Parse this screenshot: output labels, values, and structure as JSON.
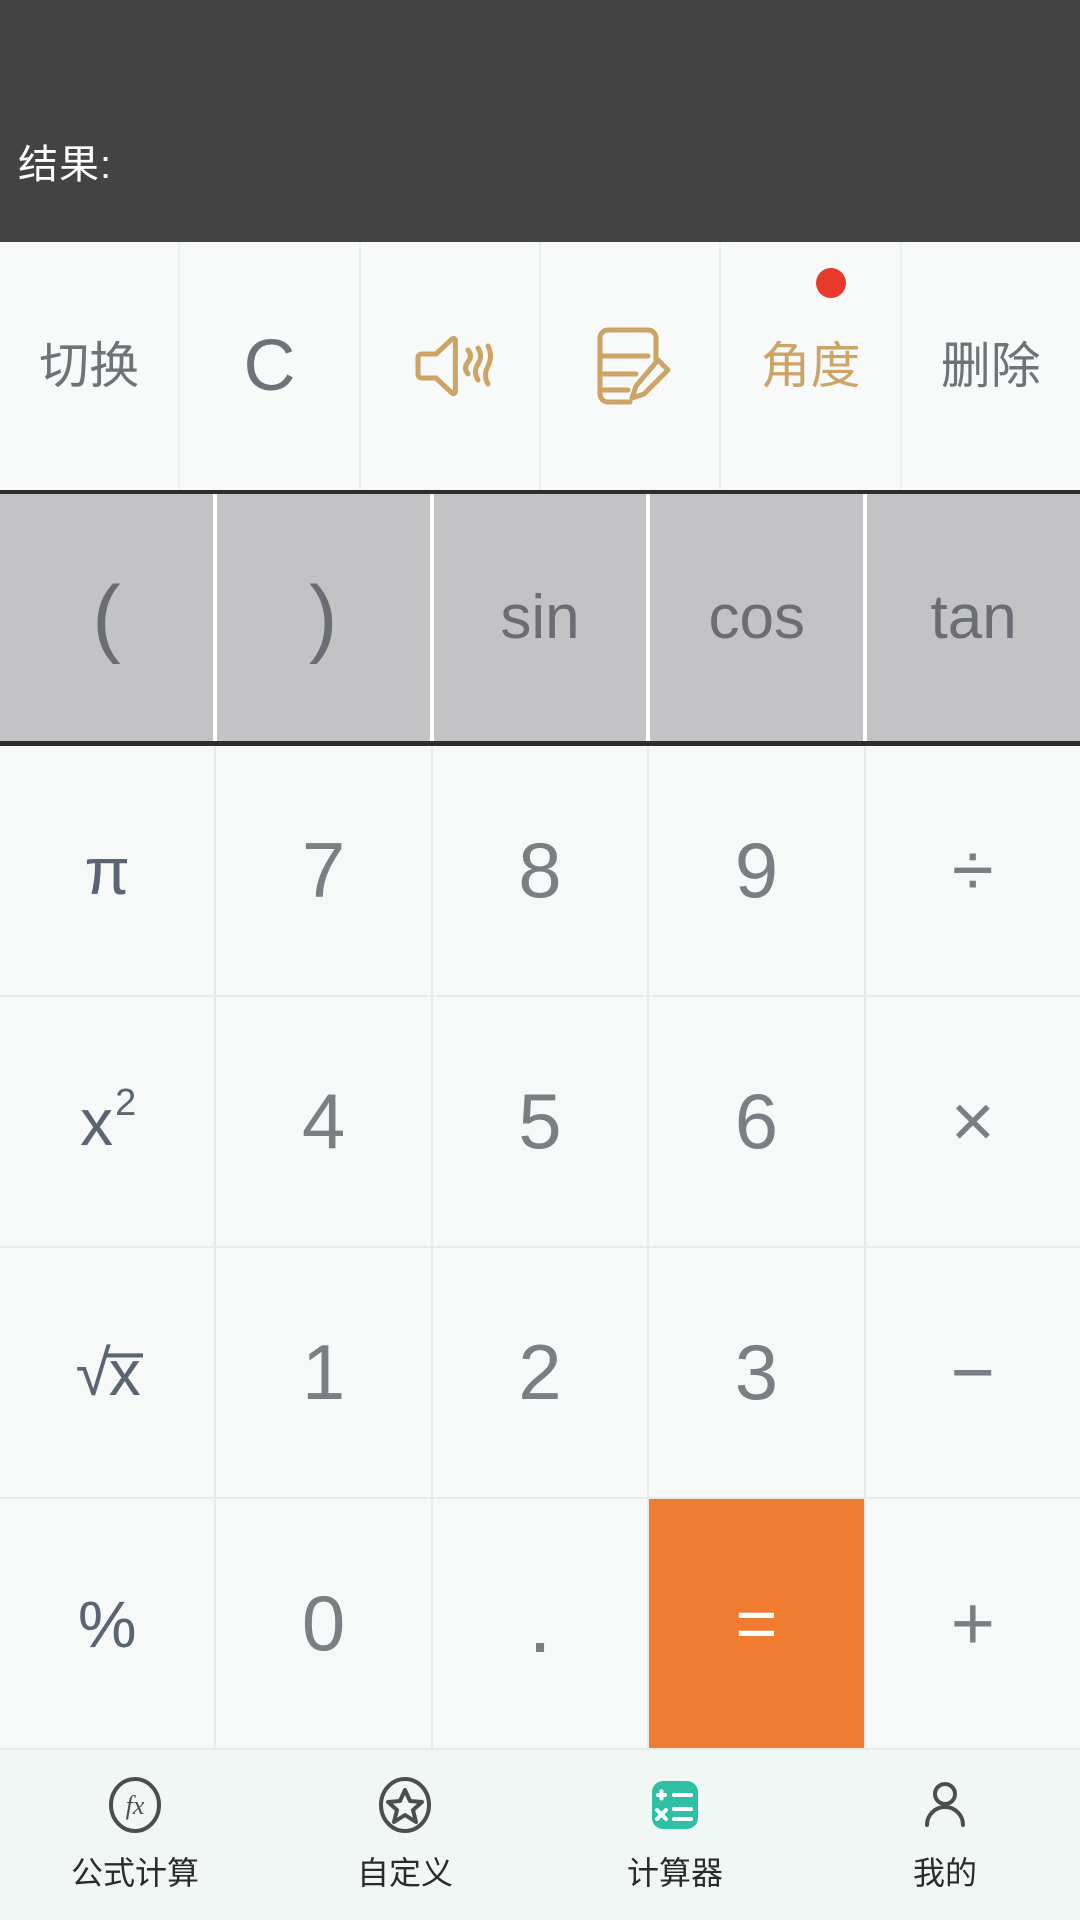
{
  "display": {
    "result_label": "结果:",
    "expression": "",
    "background": "#434343"
  },
  "toolbar": {
    "items": [
      {
        "label": "切换",
        "icon": "switch-text",
        "style": "cn",
        "badge": false
      },
      {
        "label": "C",
        "icon": "clear-text",
        "style": "big-c",
        "badge": false
      },
      {
        "label": "",
        "icon": "speaker-wave-icon",
        "style": "gold",
        "badge": false
      },
      {
        "label": "",
        "icon": "note-pencil-icon",
        "style": "gold",
        "badge": false
      },
      {
        "label": "角度",
        "icon": "angle-text",
        "style": "gold",
        "badge": true
      },
      {
        "label": "删除",
        "icon": "delete-text",
        "style": "cn",
        "badge": false
      }
    ],
    "badge_color": "#e8392a",
    "gold_color": "#cda366"
  },
  "function_row": {
    "background": "#c3c3c5",
    "keys": [
      {
        "label": "(",
        "name": "open-paren"
      },
      {
        "label": ")",
        "name": "close-paren"
      },
      {
        "label": "sin",
        "name": "sin"
      },
      {
        "label": "cos",
        "name": "cos"
      },
      {
        "label": "tan",
        "name": "tan"
      }
    ]
  },
  "keypad": {
    "accent": "#f07c32",
    "fn_color": "#5b6472",
    "digit_color": "#7b7e83",
    "rows": [
      [
        {
          "label": "π",
          "name": "pi",
          "kind": "fn"
        },
        {
          "label": "7",
          "name": "digit-7",
          "kind": "digit"
        },
        {
          "label": "8",
          "name": "digit-8",
          "kind": "digit"
        },
        {
          "label": "9",
          "name": "digit-9",
          "kind": "digit"
        },
        {
          "label": "÷",
          "name": "divide",
          "kind": "op"
        }
      ],
      [
        {
          "label": "x²",
          "name": "square",
          "kind": "fn"
        },
        {
          "label": "4",
          "name": "digit-4",
          "kind": "digit"
        },
        {
          "label": "5",
          "name": "digit-5",
          "kind": "digit"
        },
        {
          "label": "6",
          "name": "digit-6",
          "kind": "digit"
        },
        {
          "label": "×",
          "name": "multiply",
          "kind": "op"
        }
      ],
      [
        {
          "label": "√x",
          "name": "sqrt",
          "kind": "fn"
        },
        {
          "label": "1",
          "name": "digit-1",
          "kind": "digit"
        },
        {
          "label": "2",
          "name": "digit-2",
          "kind": "digit"
        },
        {
          "label": "3",
          "name": "digit-3",
          "kind": "digit"
        },
        {
          "label": "−",
          "name": "minus",
          "kind": "op"
        }
      ],
      [
        {
          "label": "%",
          "name": "percent",
          "kind": "fn"
        },
        {
          "label": "0",
          "name": "digit-0",
          "kind": "digit"
        },
        {
          "label": ".",
          "name": "decimal",
          "kind": "dot"
        },
        {
          "label": "=",
          "name": "equals",
          "kind": "equals"
        },
        {
          "label": "+",
          "name": "plus",
          "kind": "op"
        }
      ]
    ]
  },
  "bottom_nav": {
    "active_color": "#2fbfa4",
    "items": [
      {
        "label": "公式计算",
        "icon": "fx-circle-icon",
        "name": "formula-calc",
        "active": false
      },
      {
        "label": "自定义",
        "icon": "star-circle-icon",
        "name": "custom",
        "active": false
      },
      {
        "label": "计算器",
        "icon": "calculator-icon",
        "name": "calculator",
        "active": true
      },
      {
        "label": "我的",
        "icon": "person-icon",
        "name": "mine",
        "active": false
      }
    ]
  }
}
